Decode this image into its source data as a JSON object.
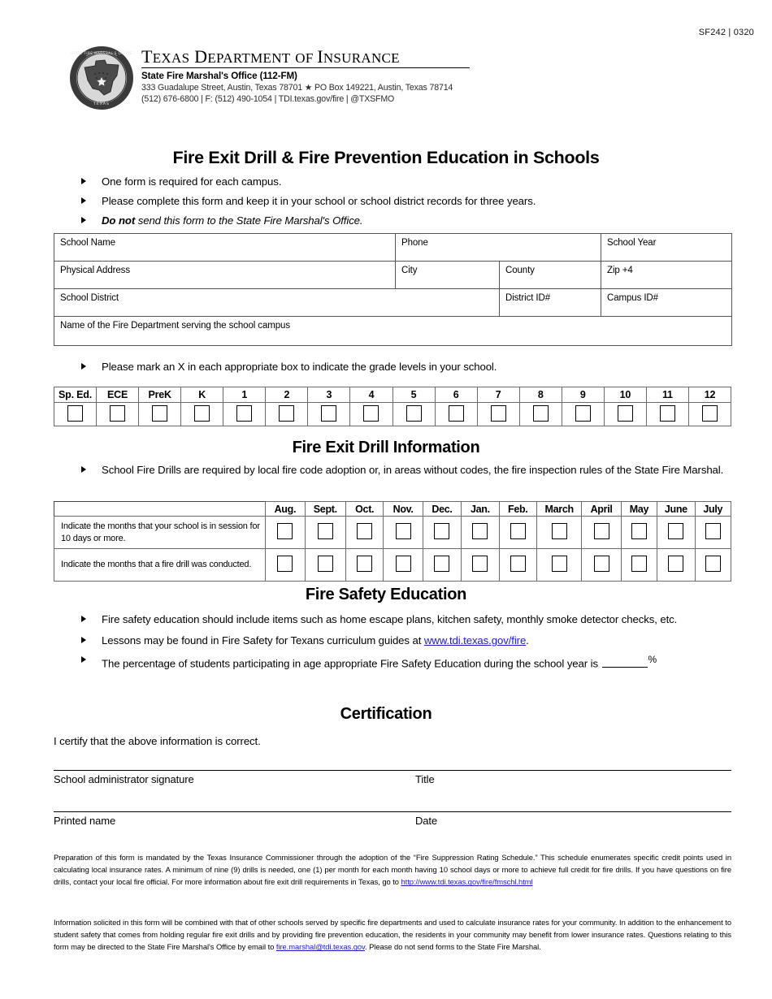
{
  "form_number": "SF242 | 0320",
  "letterhead": {
    "seal_alt": "state-fire-marshal-seal",
    "agency_name": "Texas Department of Insurance",
    "office": "State Fire Marshal's Office (112-FM)",
    "address_line": "333 Guadalupe Street, Austin, Texas 78701 ★ PO Box 149221, Austin, Texas 78714",
    "contact_line": "(512) 676-6800 | F: (512) 490-1054 |  TDI.texas.gov/fire | @TXSFMO"
  },
  "main_title": "Fire Exit Drill & Fire Prevention Education in Schools",
  "intro_bullets": [
    {
      "text": "One form is required for each campus."
    },
    {
      "text": "Please complete this form and keep it in your school or school district records for three years."
    },
    {
      "bold_italic": "Do not",
      "italic": " send this form to the State Fire Marshal's Office."
    }
  ],
  "school_table": {
    "school_name": "School Name",
    "phone": "Phone",
    "school_year": "School Year",
    "physical_address": "Physical Address",
    "city": "City",
    "county": "County",
    "zip": "Zip +4",
    "school_district": "School District",
    "district_id": "District ID#",
    "campus_id": "Campus ID#",
    "fire_department": "Name of the Fire Department serving the school campus"
  },
  "grade_instruction": "Please mark an X in each appropriate box to indicate the grade levels in your school.",
  "grade_levels": [
    "Sp. Ed.",
    "ECE",
    "PreK",
    "K",
    "1",
    "2",
    "3",
    "4",
    "5",
    "6",
    "7",
    "8",
    "9",
    "10",
    "11",
    "12"
  ],
  "drill_section": {
    "title": "Fire Exit Drill Information",
    "bullet": "School Fire Drills are required by local fire code adoption or, in areas without codes, the fire inspection rules of the State Fire Marshal."
  },
  "months_table": {
    "months": [
      "Aug.",
      "Sept.",
      "Oct.",
      "Nov.",
      "Dec.",
      "Jan.",
      "Feb.",
      "March",
      "April",
      "May",
      "June",
      "July"
    ],
    "row1_label": "Indicate the months that your school is in session for 10 days or more.",
    "row2_label": "Indicate the months that a fire drill was conducted."
  },
  "safety_section": {
    "title": "Fire Safety Education",
    "bullet1": "Fire safety education should include items such as home escape plans, kitchen safety, monthly smoke detector checks, etc.",
    "bullet2_prefix": "Lessons may be found in Fire Safety for Texans curriculum guides at ",
    "bullet2_link": "www.tdi.texas.gov/fire",
    "bullet2_suffix": ".",
    "bullet3_prefix": "The percentage of students participating in age appropriate Fire Safety Education during the school year is ",
    "bullet3_percent": "%"
  },
  "certification": {
    "title": "Certification",
    "statement": "I certify that the above information is correct.",
    "signature_label": "School administrator signature",
    "title_label": "Title",
    "printed_name_label": "Printed name",
    "date_label": "Date"
  },
  "fineprint": {
    "paragraph1_a": "Preparation of this form is mandated by the Texas Insurance Commissioner through the adoption of the “Fire Suppression Rating Schedule.”   This schedule enumerates specific credit points used in calculating local insurance rates.  A minimum of nine (9) drills is needed, one (1) per month for each month having 10 school days or more to achieve full credit for fire drills.  If you have questions on fire drills, contact your local fire official.   For more information about fire exit drill requirements in Texas, go to ",
    "paragraph1_link": "http://www.tdi.texas.gov/fire/fmschl.html",
    "paragraph2_a": "Information solicited in this form will be combined with that of other schools served by specific fire departments and used to calculate insurance rates for your community.  In addition to the enhancement to student safety that comes from holding regular fire exit drills and by providing fire prevention education, the residents in your community may benefit from lower insurance rates.  Questions relating to this form may be directed to the State Fire Marshal's Office by email to ",
    "paragraph2_link": "fire.marshal@tdi.texas.gov",
    "paragraph2_b": ".  Please do not send forms to the State Fire Marshal."
  }
}
